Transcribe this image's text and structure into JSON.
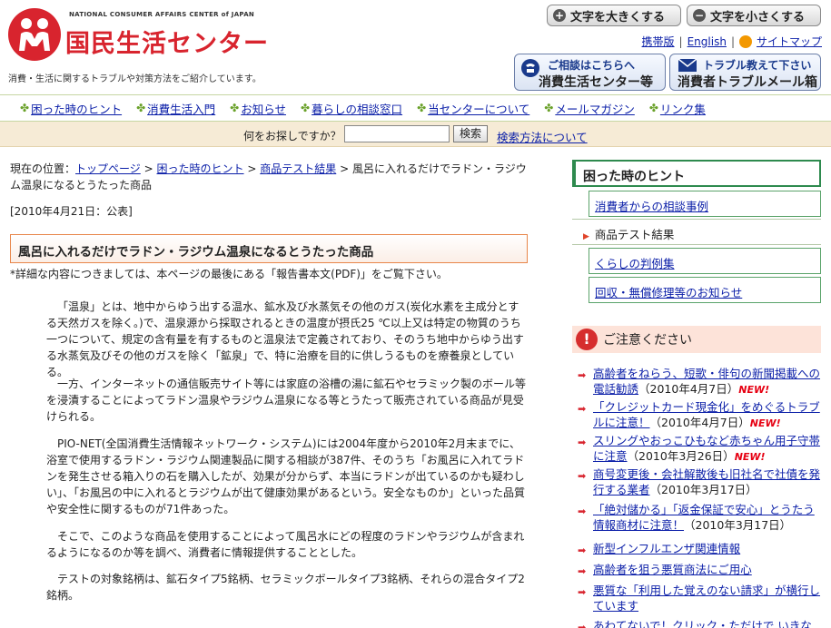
{
  "header": {
    "org_en": "NATIONAL CONSUMER AFFAIRS CENTER of JAPAN",
    "org_jp": "国民生活センター",
    "tagline": "消費・生活に関するトラブルや対策方法をご紹介しています。",
    "font_larger": "文字を大きくする",
    "font_smaller": "文字を小さくする",
    "links": [
      "携帯版",
      "English",
      "サイトマップ"
    ],
    "consult_l1": "ご相談はこちらへ",
    "consult_l2": "消費生活センター等",
    "mail_l1": "トラブル教えて下さい",
    "mail_l2": "消費者トラブルメール箱"
  },
  "nav": [
    "困った時のヒント",
    "消費生活入門",
    "お知らせ",
    "暮らしの相談窓口",
    "当センターについて",
    "メールマガジン",
    "リンク集"
  ],
  "search": {
    "label": "何をお探しですか？",
    "value": "",
    "button": "検索",
    "how": "検索方法について"
  },
  "breadcrumb": {
    "prefix": "現在の位置：",
    "items": [
      "トップページ",
      "困った時のヒント",
      "商品テスト結果"
    ],
    "current": "風呂に入れるだけでラドン・ラジウム温泉になるとうたった商品",
    "sep": ">"
  },
  "article": {
    "date": "[2010年4月21日：公表]",
    "title": "風呂に入れるだけでラドン・ラジウム温泉になるとうたった商品",
    "note": "*詳細な内容につきましては、本ページの最後にある「報告書本文(PDF)」をご覧下さい。",
    "paragraphs": [
      "「温泉」とは、地中からゆう出する温水、鉱水及び水蒸気その他のガス(炭化水素を主成分とする天然ガスを除く。)で、温泉源から採取されるときの温度が摂氏25 ℃以上又は特定の物質のうち一つについて、規定の含有量を有するものと温泉法で定義されており、そのうち地中からゆう出する水蒸気及びその他のガスを除く「鉱泉」で、特に治療を目的に供しうるものを療養泉としている。",
      "一方、インターネットの通信販売サイト等には家庭の浴槽の湯に鉱石やセラミック製のボール等を浸漬することによってラドン温泉やラジウム温泉になる等とうたって販売されている商品が見受けられる。",
      "PIO-NET(全国消費生活情報ネットワーク・システム)には2004年度から2010年2月末までに、浴室で使用するラドン・ラジウム関連製品に関する相談が387件、そのうち「お風呂に入れてラドンを発生させる箱入りの石を購入したが、効果が分からず、本当にラドンが出ているのかも疑わしい」、「お風呂の中に入れるとラジウムが出て健康効果があるという。安全なものか」といった品質や安全性に関するものが71件あった。",
      "そこで、このような商品を使用することによって風呂水にどの程度のラドンやラジウムが含まれるようになるのか等を調べ、消費者に情報提供することとした。",
      "テストの対象銘柄は、鉱石タイプ5銘柄、セラミックボールタイプ3銘柄、それらの混合タイプ2銘柄。"
    ]
  },
  "sidebar": {
    "heading": "困った時のヒント",
    "items": [
      "消費者からの相談事例",
      "商品テスト結果",
      "くらしの判例集",
      "回収・無償修理等のお知らせ"
    ],
    "warn_title": "ご注意ください",
    "news": [
      {
        "text": "高齢者をねらう、短歌・俳句の新聞掲載への電話勧誘",
        "date": "（2010年4月7日）",
        "new": "NEW!"
      },
      {
        "text": "「クレジットカード現金化」をめぐるトラブルに注意！",
        "date": "（2010年4月7日）",
        "new": "NEW!"
      },
      {
        "text": "スリングやおっこひもなど赤ちゃん用子守帯に注意",
        "date": "（2010年3月26日）",
        "new": "NEW!"
      },
      {
        "text": "商号変更後・会社解散後も旧社名で社債を発行する業者",
        "date": "（2010年3月17日）",
        "new": ""
      },
      {
        "text": "「絶対儲かる」「返金保証で安心」とうたう情報商材に注意！",
        "date": "（2010年3月17日）",
        "new": ""
      },
      {
        "text": "新型インフルエンザ関連情報",
        "date": "",
        "new": ""
      },
      {
        "text": "高齢者を狙う悪質商法にご用心",
        "date": "",
        "new": ""
      },
      {
        "text": "悪質な「利用した覚えのない請求」が横行しています",
        "date": "",
        "new": ""
      },
      {
        "text": "あわてないで！クリック・ただけで いきなり",
        "date": "",
        "new": ""
      }
    ]
  },
  "colors": {
    "brand_red": "#d8242e",
    "nav_green": "#6aa12a",
    "link_blue": "#0b1fa8",
    "new_red": "#e60012"
  }
}
